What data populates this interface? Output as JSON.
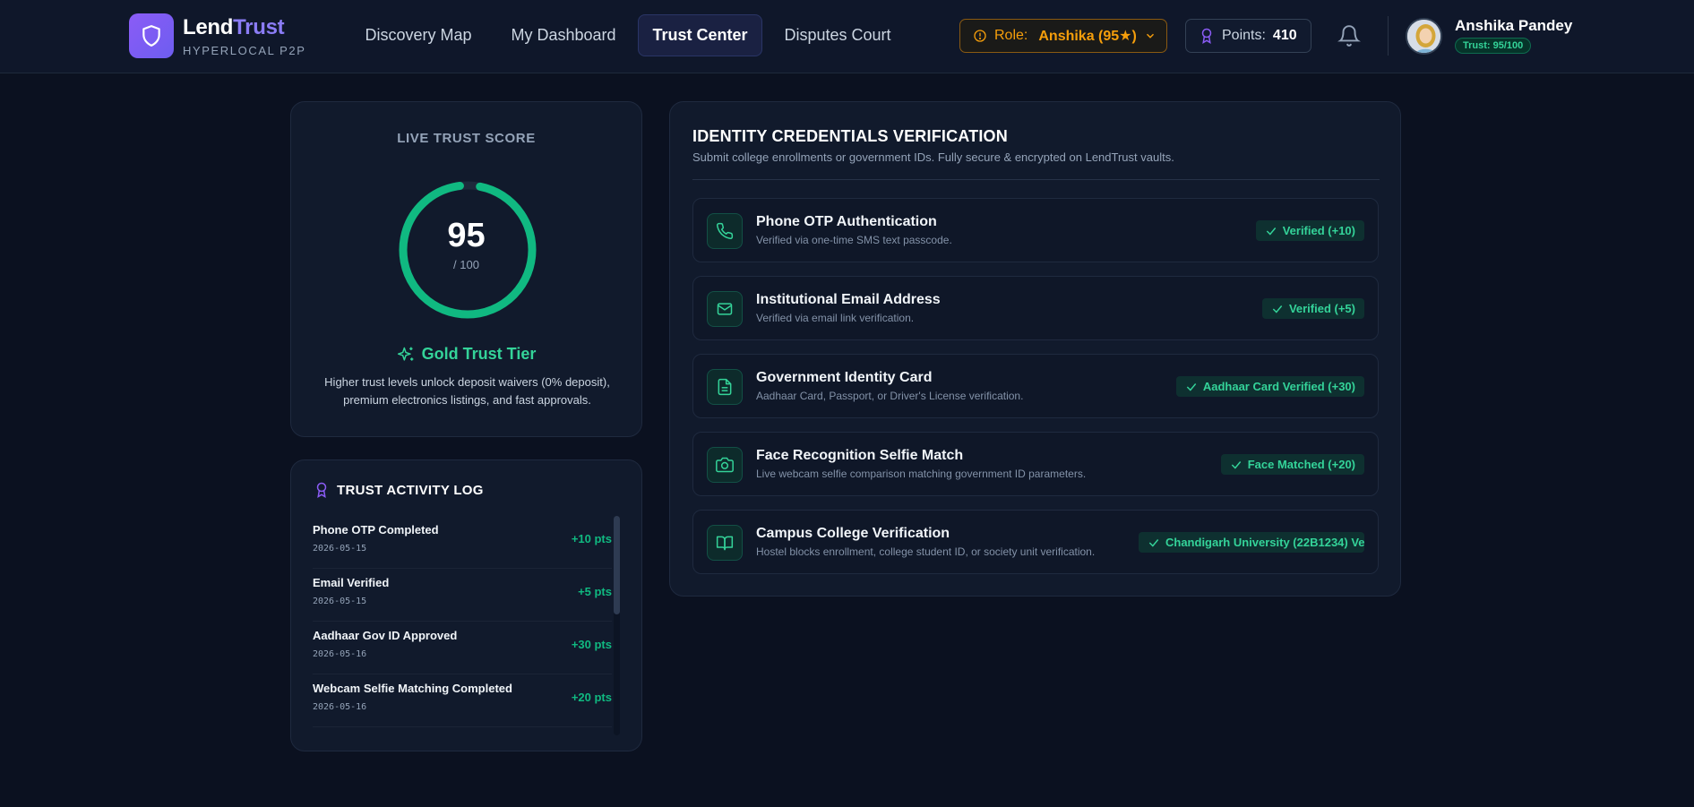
{
  "brand": {
    "name_main": "Lend",
    "name_accent": "Trust",
    "subtitle": "HYPERLOCAL P2P"
  },
  "nav": [
    {
      "label": "Discovery Map"
    },
    {
      "label": "My Dashboard"
    },
    {
      "label": "Trust Center",
      "active": true
    },
    {
      "label": "Disputes Court"
    }
  ],
  "role": {
    "label": "Role:",
    "value": "Anshika (95★)"
  },
  "points": {
    "label": "Points:",
    "value": "410"
  },
  "user": {
    "name": "Anshika Pandey",
    "trust": "Trust: 95/100"
  },
  "score": {
    "title": "LIVE TRUST SCORE",
    "value": "95",
    "max": "/ 100",
    "fraction": 0.95,
    "tier": "Gold Trust Tier",
    "description": "Higher trust levels unlock deposit waivers (0% deposit), premium electronics listings, and fast approvals."
  },
  "log": {
    "title": "TRUST ACTIVITY LOG",
    "items": [
      {
        "title": "Phone OTP Completed",
        "date": "2026-05-15",
        "points": "+10 pts"
      },
      {
        "title": "Email Verified",
        "date": "2026-05-15",
        "points": "+5 pts"
      },
      {
        "title": "Aadhaar Gov ID Approved",
        "date": "2026-05-16",
        "points": "+30 pts"
      },
      {
        "title": "Webcam Selfie Matching Completed",
        "date": "2026-05-16",
        "points": "+20 pts"
      }
    ]
  },
  "identity": {
    "title": "IDENTITY CREDENTIALS VERIFICATION",
    "subtitle": "Submit college enrollments or government IDs. Fully secure & encrypted on LendTrust vaults.",
    "items": [
      {
        "icon": "phone-icon",
        "title": "Phone OTP Authentication",
        "desc": "Verified via one-time SMS text passcode.",
        "badge": "Verified (+10)"
      },
      {
        "icon": "mail-icon",
        "title": "Institutional Email Address",
        "desc": "Verified via email link verification.",
        "badge": "Verified (+5)"
      },
      {
        "icon": "document-icon",
        "title": "Government Identity Card",
        "desc": "Aadhaar Card, Passport, or Driver's License verification.",
        "badge": "Aadhaar Card Verified (+30)"
      },
      {
        "icon": "camera-icon",
        "title": "Face Recognition Selfie Match",
        "desc": "Live webcam selfie comparison matching government ID parameters.",
        "badge": "Face Matched (+20)"
      },
      {
        "icon": "book-icon",
        "title": "Campus College Verification",
        "desc": "Hostel blocks enrollment, college student ID, or society unit verification.",
        "badge": "Chandigarh University (22B1234) Ve"
      }
    ]
  },
  "colors": {
    "accent": "#8b5cf6",
    "success": "#10b981",
    "warning": "#f59e0b",
    "background": "#0b1120"
  }
}
